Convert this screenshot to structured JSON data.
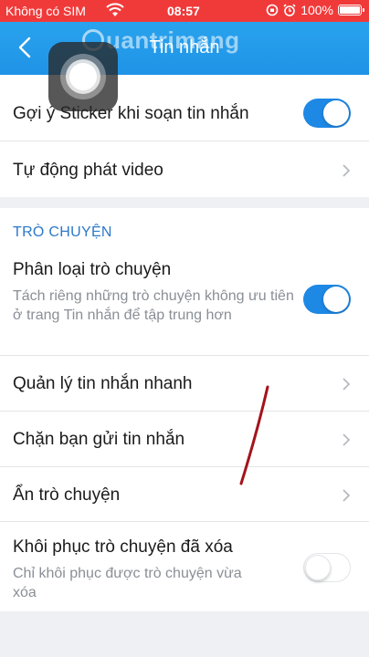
{
  "status_bar": {
    "carrier": "Không có SIM",
    "time": "08:57",
    "battery": "100%"
  },
  "nav": {
    "title": "Tin nhắn",
    "watermark": "uantrimang"
  },
  "section1": {
    "rows": [
      {
        "label": "Gợi ý Sticker khi soạn tin nhắn",
        "control": "toggle",
        "on": true
      },
      {
        "label": "Tự động phát video",
        "control": "chevron"
      }
    ]
  },
  "section2": {
    "header": "TRÒ CHUYỆN",
    "rows": [
      {
        "label": "Phân loại trò chuyện",
        "desc": "Tách riêng những trò chuyện không ưu tiên ở trang Tin nhắn để tập trung hơn",
        "control": "toggle",
        "on": true
      },
      {
        "label": "Quản lý tin nhắn nhanh",
        "control": "chevron"
      },
      {
        "label": "Chặn bạn gửi tin nhắn",
        "control": "chevron"
      },
      {
        "label": "Ẩn trò chuyện",
        "control": "chevron"
      },
      {
        "label": "Khôi phục trò chuyện đã xóa",
        "desc": "Chỉ khôi phục được trò chuyện vừa xóa",
        "control": "toggle",
        "on": false
      }
    ]
  },
  "colors": {
    "status_bar": "#f03a3a",
    "nav_bar": "#1f93e6",
    "accent": "#1e88e5",
    "section_header": "#2d78c8",
    "annotation_line": "#a3141c"
  }
}
